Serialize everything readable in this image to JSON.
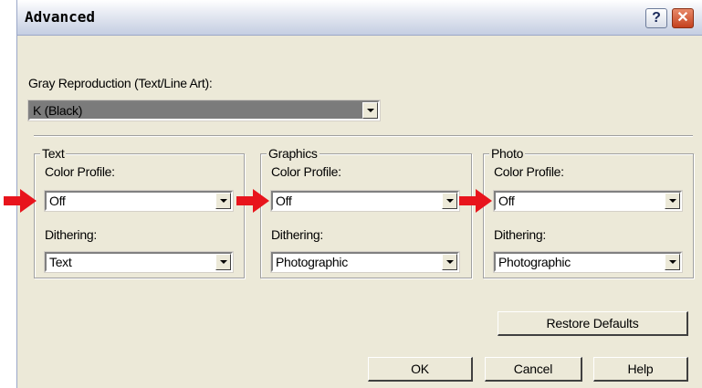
{
  "window": {
    "title": "Advanced",
    "help_symbol": "?",
    "close_symbol": "✕"
  },
  "gray_reproduction": {
    "label": "Gray Reproduction (Text/Line Art):",
    "value": "K (Black)"
  },
  "groups": {
    "text": {
      "title": "Text",
      "color_profile_label": "Color Profile:",
      "color_profile_value": "Off",
      "dithering_label": "Dithering:",
      "dithering_value": "Text"
    },
    "graphics": {
      "title": "Graphics",
      "color_profile_label": "Color Profile:",
      "color_profile_value": "Off",
      "dithering_label": "Dithering:",
      "dithering_value": "Photographic"
    },
    "photo": {
      "title": "Photo",
      "color_profile_label": "Color Profile:",
      "color_profile_value": "Off",
      "dithering_label": "Dithering:",
      "dithering_value": "Photographic"
    }
  },
  "buttons": {
    "restore_defaults": "Restore Defaults",
    "ok": "OK",
    "cancel": "Cancel",
    "help": "Help"
  },
  "colors": {
    "annotation_arrow": "#e8141c",
    "dialog_background": "#ece9d8"
  }
}
